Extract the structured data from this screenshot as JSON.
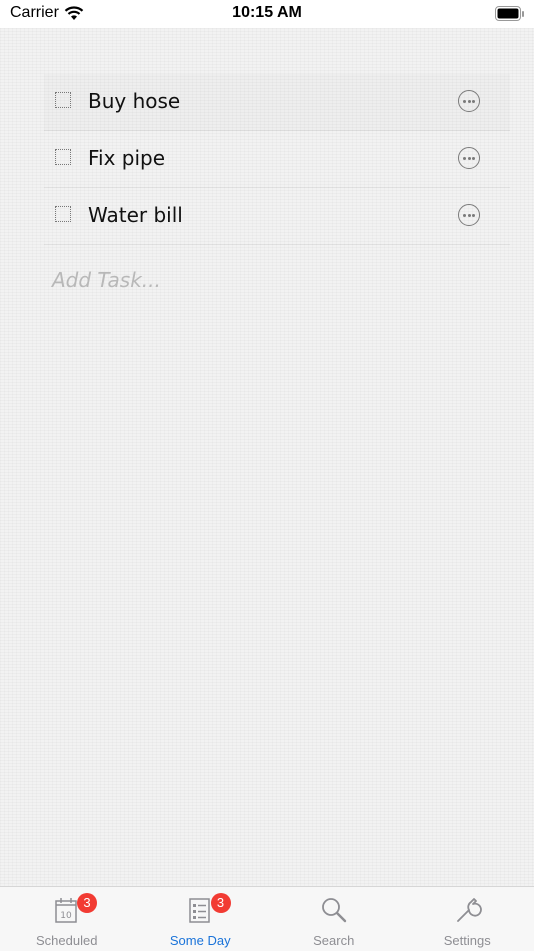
{
  "status_bar": {
    "carrier": "Carrier",
    "time": "10:15 AM"
  },
  "tasks": [
    {
      "label": "Buy hose"
    },
    {
      "label": "Fix pipe"
    },
    {
      "label": "Water bill"
    }
  ],
  "add_task_placeholder": "Add Task...",
  "tab_bar": {
    "tabs": [
      {
        "label": "Scheduled",
        "icon": "calendar-icon",
        "badge": "3",
        "active": false
      },
      {
        "label": "Some Day",
        "icon": "checklist-icon",
        "badge": "3",
        "active": true
      },
      {
        "label": "Search",
        "icon": "search-icon",
        "active": false
      },
      {
        "label": "Settings",
        "icon": "wrench-icon",
        "active": false
      }
    ]
  },
  "colors": {
    "accent": "#1a73d9",
    "badge": "#f23b33",
    "inactive_tab": "#8e8e93"
  }
}
